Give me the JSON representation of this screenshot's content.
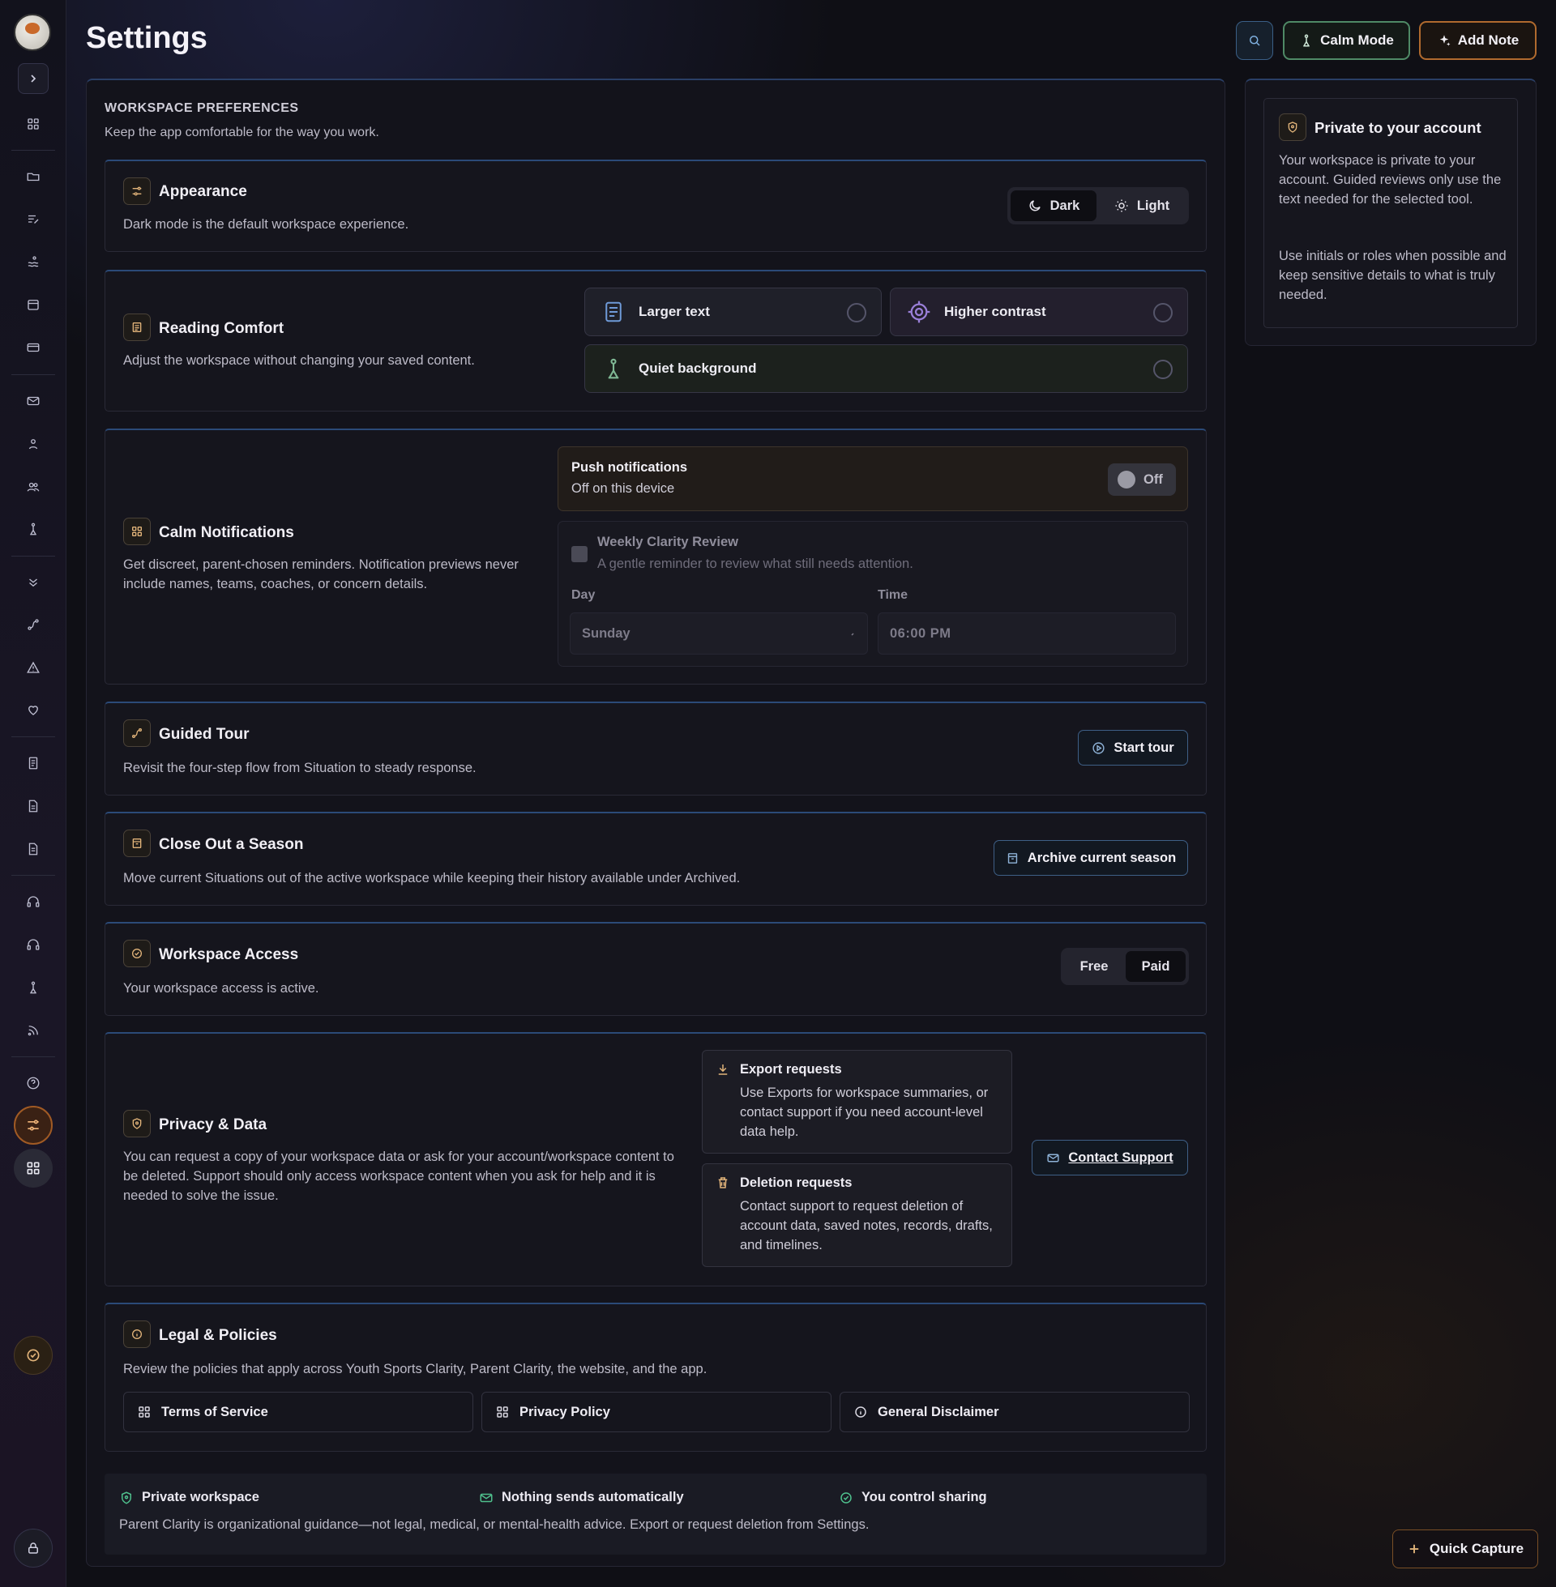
{
  "header": {
    "title": "Settings",
    "calm_mode_label": "Calm Mode",
    "add_note_label": "Add Note"
  },
  "workspace": {
    "kicker": "WORKSPACE PREFERENCES",
    "subtitle": "Keep the app comfortable for the way you work."
  },
  "appearance": {
    "title": "Appearance",
    "desc": "Dark mode is the default workspace experience.",
    "options": [
      "Dark",
      "Light"
    ],
    "selected": "Dark"
  },
  "reading": {
    "title": "Reading Comfort",
    "desc": "Adjust the workspace without changing your saved content.",
    "options": [
      {
        "label": "Larger text",
        "icon": "document-lines-icon",
        "checked": false
      },
      {
        "label": "Higher contrast",
        "icon": "target-icon",
        "checked": false
      },
      {
        "label": "Quiet background",
        "icon": "figure-icon",
        "checked": false
      }
    ]
  },
  "notifications": {
    "title": "Calm Notifications",
    "desc": "Get discreet, parent-chosen reminders. Notification previews never include names, teams, coaches, or concern details.",
    "push_title": "Push notifications",
    "push_status": "Off on this device",
    "toggle_label": "Off",
    "weekly_title": "Weekly Clarity Review",
    "weekly_desc": "A gentle reminder to review what still needs attention.",
    "day_label": "Day",
    "day_value": "Sunday",
    "time_label": "Time",
    "time_value": "06:00 PM"
  },
  "tour": {
    "title": "Guided Tour",
    "desc": "Revisit the four-step flow from Situation to steady response.",
    "button": "Start tour"
  },
  "season": {
    "title": "Close Out a Season",
    "desc": "Move current Situations out of the active workspace while keeping their history available under Archived.",
    "button": "Archive current season"
  },
  "access": {
    "title": "Workspace Access",
    "desc": "Your workspace access is active.",
    "options": [
      "Free",
      "Paid"
    ],
    "selected": "Paid"
  },
  "privacy": {
    "title": "Privacy & Data",
    "desc": "You can request a copy of your workspace data or ask for your account/workspace content to be deleted. Support should only access workspace content when you ask for help and it is needed to solve the issue.",
    "export_title": "Export requests",
    "export_desc": "Use Exports for workspace summaries, or contact support if you need account-level data help.",
    "deletion_title": "Deletion requests",
    "deletion_desc": "Contact support to request deletion of account data, saved notes, records, drafts, and timelines.",
    "button": "Contact Support"
  },
  "legal": {
    "title": "Legal & Policies",
    "desc": "Review the policies that apply across Youth Sports Clarity, Parent Clarity, the website, and the app.",
    "links": [
      "Terms of Service",
      "Privacy Policy",
      "General Disclaimer"
    ]
  },
  "footer": {
    "items": [
      "Private workspace",
      "Nothing sends automatically",
      "You control sharing"
    ],
    "disclaimer": "Parent Clarity is organizational guidance—not legal, medical, or mental-health advice. Export or request deletion from Settings."
  },
  "side": {
    "title": "Private to your account",
    "p1": "Your workspace is private to your account. Guided reviews only use the text needed for the selected tool.",
    "p2": "Use initials or roles when possible and keep sensitive details to what is truly needed."
  },
  "quick_capture": "Quick Capture",
  "colors": {
    "accent_orange": "#e2b47a",
    "accent_blue": "#2b4a78",
    "success_green": "#4fc08d",
    "calm_green": "#4f8a66"
  }
}
